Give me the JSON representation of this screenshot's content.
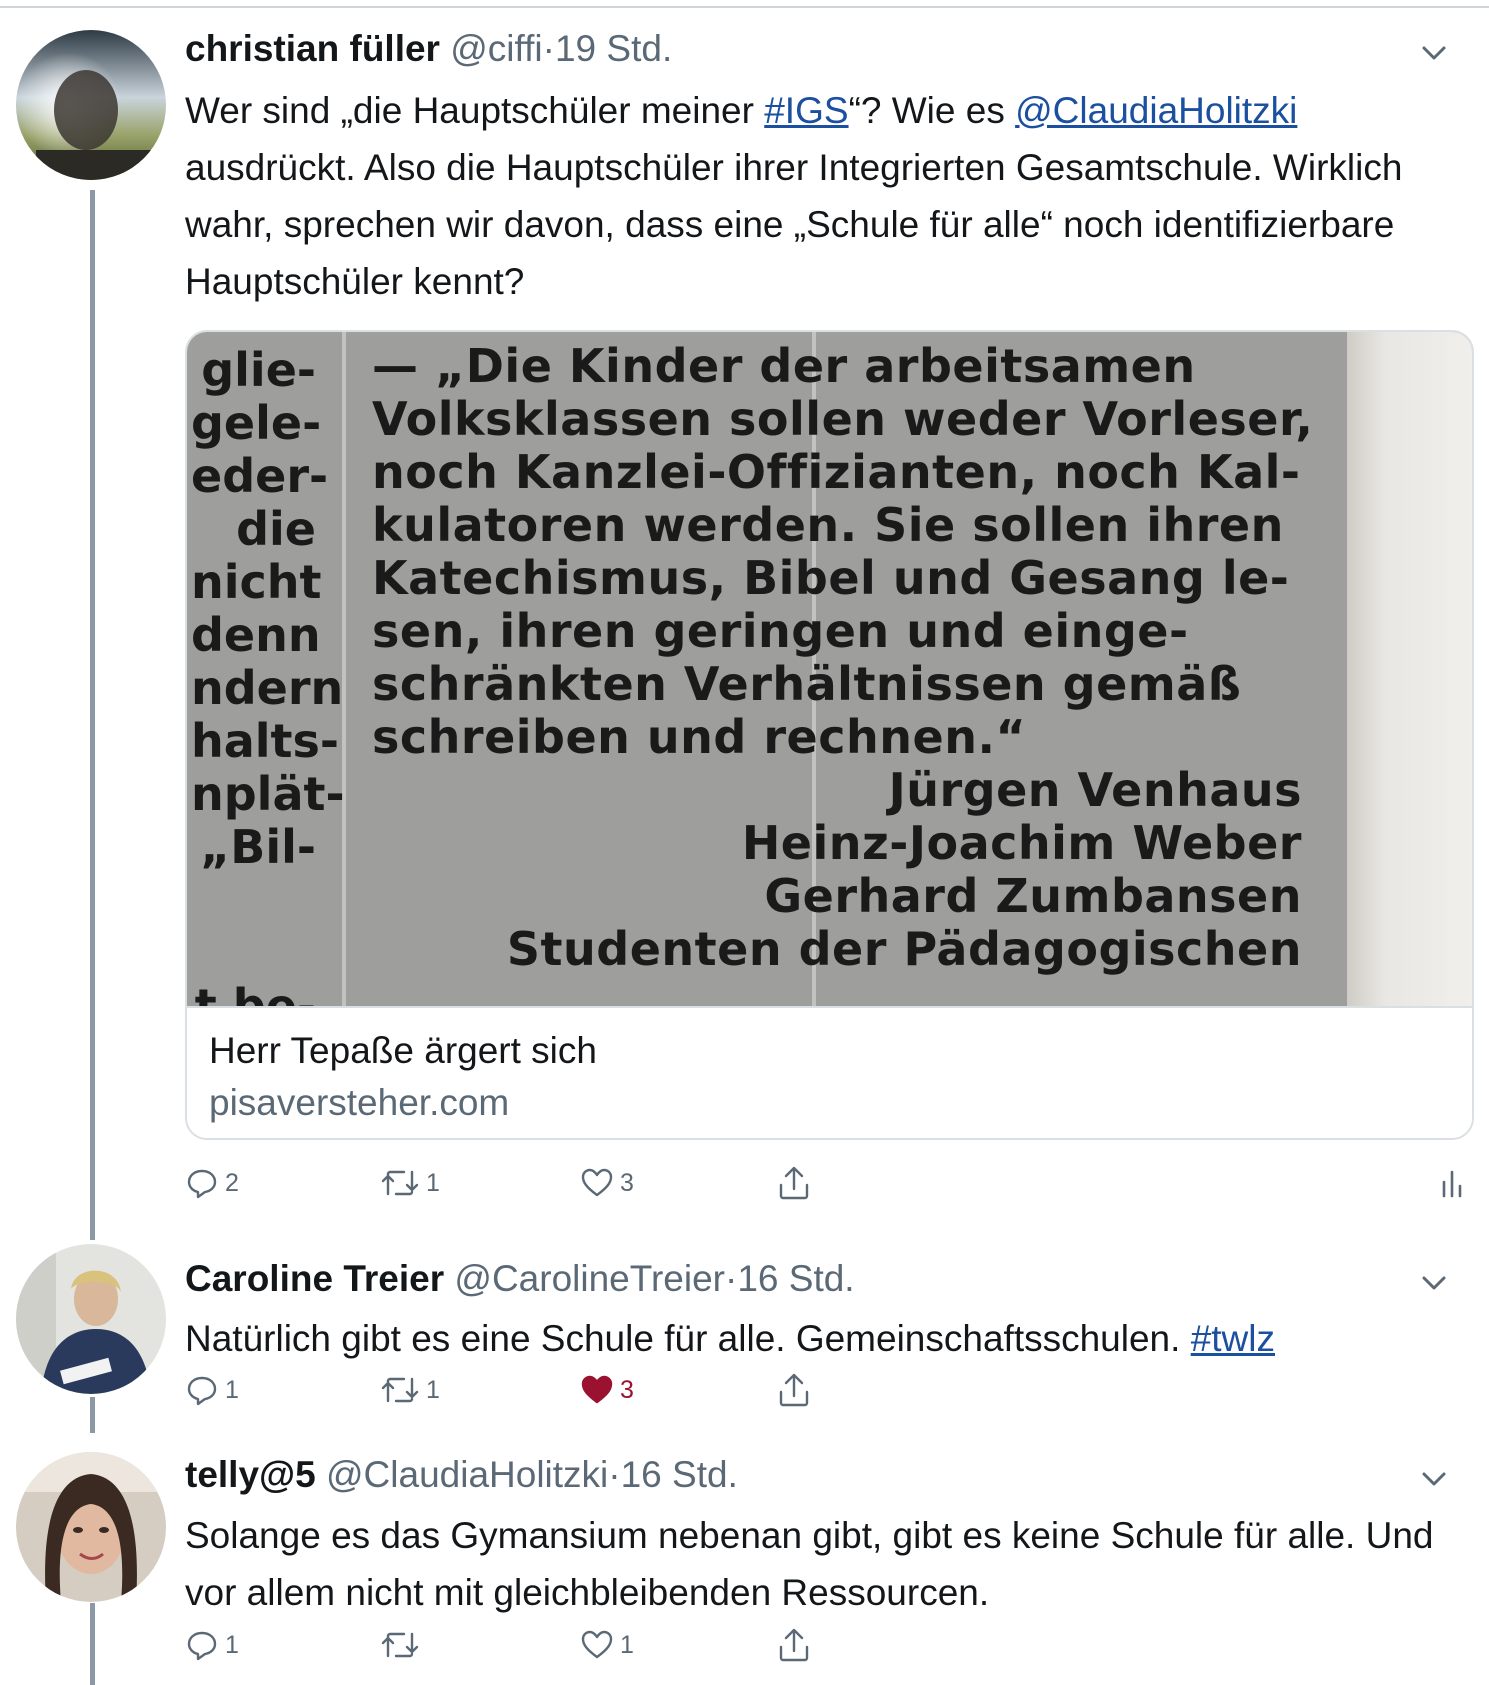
{
  "tweets": [
    {
      "name": "christian füller",
      "handle": "@ciffi",
      "sep": "·",
      "time": "19 Std.",
      "text": {
        "t1": "Wer sind „die Hauptschüler meiner ",
        "link1": "#IGS",
        "t2": "“? Wie es ",
        "link2": "@ClaudiaHolitzki",
        "t3": " ausdrückt. Also die Hauptschüler ihrer Integrierten Gesamtschule. Wirklich wahr, sprechen wir davon, dass eine „Schule für alle“ noch identifizierbare Hauptschüler kennt?"
      },
      "card": {
        "title": "Herr Tepaße ärgert sich",
        "domain": "pisaversteher.com",
        "scan_left": "glie-\ngele-\neder-\ndie\nnicht\ndenn\nndern\nhalts-\nnplät-\n„Bil-\n\n\nt be-",
        "scan_lines": [
          "— „Die Kinder der arbeitsamen",
          "Volksklassen sollen weder Vorleser,",
          "noch Kanzlei-Offizianten, noch Kal-",
          "kulatoren werden. Sie sollen ihren",
          "Katechismus, Bibel und Gesang le-",
          "sen, ihren geringen und einge-",
          "schränkten Verhältnissen gemäß",
          "schreiben und rechnen.“"
        ],
        "scan_signature": [
          "Jürgen Venhaus",
          "Heinz-Joachim Weber",
          "Gerhard Zumbansen",
          "Studenten der Pädagogischen"
        ]
      },
      "actions": {
        "reply": "2",
        "retweet": "1",
        "like": "3"
      }
    },
    {
      "name": "Caroline Treier",
      "handle": "@CarolineTreier",
      "sep": "·",
      "time": "16 Std.",
      "text": {
        "t1": "Natürlich gibt es eine Schule für alle. Gemeinschaftsschulen. ",
        "link1": "#twlz"
      },
      "actions": {
        "reply": "1",
        "retweet": "1",
        "like": "3"
      }
    },
    {
      "name": "telly@5",
      "handle": "@ClaudiaHolitzki",
      "sep": "·",
      "time": "16 Std.",
      "text": {
        "t1": "Solange es das Gymansium nebenan gibt, gibt es keine Schule für alle. Und vor allem nicht mit gleichbleibenden Ressourcen."
      },
      "actions": {
        "reply": "1",
        "retweet": "",
        "like": "1"
      }
    }
  ],
  "icons": {
    "reply": "reply-icon",
    "retweet": "retweet-icon",
    "like": "heart-icon",
    "liked": "heart-filled-icon",
    "share": "share-icon",
    "analytics": "analytics-icon",
    "more": "chevron-down-icon"
  },
  "colors": {
    "link": "#1b4fa0",
    "meta": "#5b6976",
    "liked": "#9b1230",
    "thread": "#8b98a5"
  }
}
